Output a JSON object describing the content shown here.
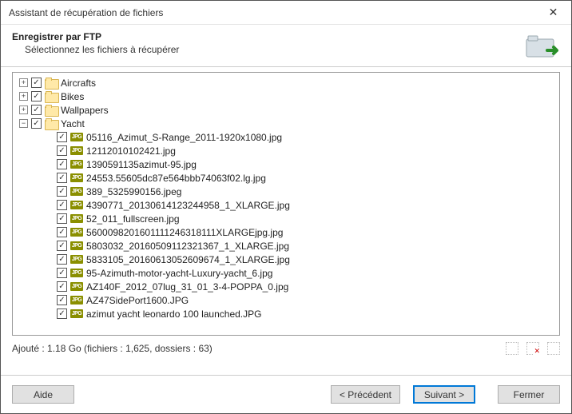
{
  "window": {
    "title": "Assistant de récupération de fichiers"
  },
  "header": {
    "main": "Enregistrer par FTP",
    "sub": "Sélectionnez les fichiers à récupérer"
  },
  "tree": {
    "folders": [
      {
        "name": "Aircrafts",
        "expanded": false,
        "checked": true
      },
      {
        "name": "Bikes",
        "expanded": false,
        "checked": true
      },
      {
        "name": "Wallpapers",
        "expanded": false,
        "checked": true
      },
      {
        "name": "Yacht",
        "expanded": true,
        "checked": true
      }
    ],
    "yacht_files": [
      "05116_Azimut_S-Range_2011-1920x1080.jpg",
      "12112010102421.jpg",
      "1390591135azimut-95.jpg",
      "24553.55605dc87e564bbb74063f02.lg.jpg",
      "389_5325990156.jpeg",
      "4390771_20130614123244958_1_XLARGE.jpg",
      "52_011_fullscreen.jpg",
      "5600098201601111246318111XLARGEjpg.jpg",
      "5803032_20160509112321367_1_XLARGE.jpg",
      "5833105_20160613052609674_1_XLARGE.jpg",
      "95-Azimuth-motor-yacht-Luxury-yacht_6.jpg",
      "AZ140F_2012_07lug_31_01_3-4-POPPA_0.jpg",
      "AZ47SidePort1600.JPG",
      "azimut yacht leonardo 100 launched.JPG"
    ],
    "jpg_badge": "JPG"
  },
  "status": {
    "text": "Ajouté : 1.18 Go (fichiers : 1,625, dossiers : 63)"
  },
  "buttons": {
    "help": "Aide",
    "prev": "< Précédent",
    "next": "Suivant >",
    "close": "Fermer"
  }
}
